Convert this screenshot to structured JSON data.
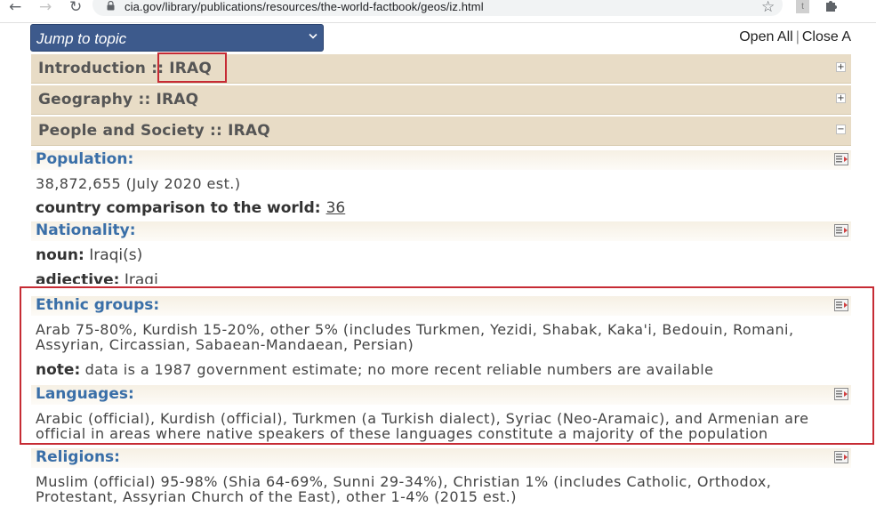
{
  "browser": {
    "url": "cia.gov/library/publications/resources/the-world-factbook/geos/iz.html",
    "back_icon": "←",
    "forward_icon": "→",
    "reload_icon": "↻",
    "star_icon": "☆",
    "ext_t": "t",
    "puzzle_icon": "✚"
  },
  "toolbar": {
    "jump_label": "Jump to topic",
    "open_all": "Open All",
    "separator": "|",
    "close_all": "Close A"
  },
  "sections": {
    "introduction": {
      "title": "Introduction ::",
      "country": "IRAQ",
      "toggle": "+"
    },
    "geography": {
      "title": "Geography ::",
      "country": "IRAQ",
      "toggle": "+"
    },
    "people": {
      "title": "People and Society ::",
      "country": "IRAQ",
      "toggle": "−"
    }
  },
  "fields": {
    "population": {
      "label": "Population",
      "colon": ":",
      "value": "38,872,655 (July 2020 est.)",
      "comparison_label": "country comparison to the world:",
      "comparison_rank": "36"
    },
    "nationality": {
      "label": "Nationality",
      "colon": ":",
      "noun_label": "noun:",
      "noun_value": "Iraqi(s)",
      "adjective_label": "adjective:",
      "adjective_value": "Iraqi"
    },
    "ethnic": {
      "label": "Ethnic groups",
      "colon": ":",
      "line1": "Arab 75-80%, Kurdish 15-20%, other 5% (includes Turkmen, Yezidi, Shabak, Kaka'i, Bedouin, Romani,",
      "line2": "Assyrian, Circassian, Sabaean-Mandaean, Persian)",
      "note_label": "note:",
      "note_value": "data is a 1987 government estimate; no more recent reliable numbers are available"
    },
    "languages": {
      "label": "Languages",
      "colon": ":",
      "line1": "Arabic (official), Kurdish (official), Turkmen (a Turkish dialect), Syriac (Neo-Aramaic), and Armenian are",
      "line2": "official in areas where native speakers of these languages constitute a majority of the population"
    },
    "religions": {
      "label": "Religions",
      "colon": ":",
      "line1": "Muslim (official) 95-98% (Shia 64-69%, Sunni 29-34%), Christian 1% (includes Catholic, Orthodox,",
      "line2": "Protestant, Assyrian Church of the East), other 1-4% (2015 est.)"
    }
  },
  "colors": {
    "section_bg": "#e8dcc6",
    "field_label": "#3a6fa8",
    "jump_bg": "#3d5a8c",
    "highlight": "#c62b34"
  }
}
